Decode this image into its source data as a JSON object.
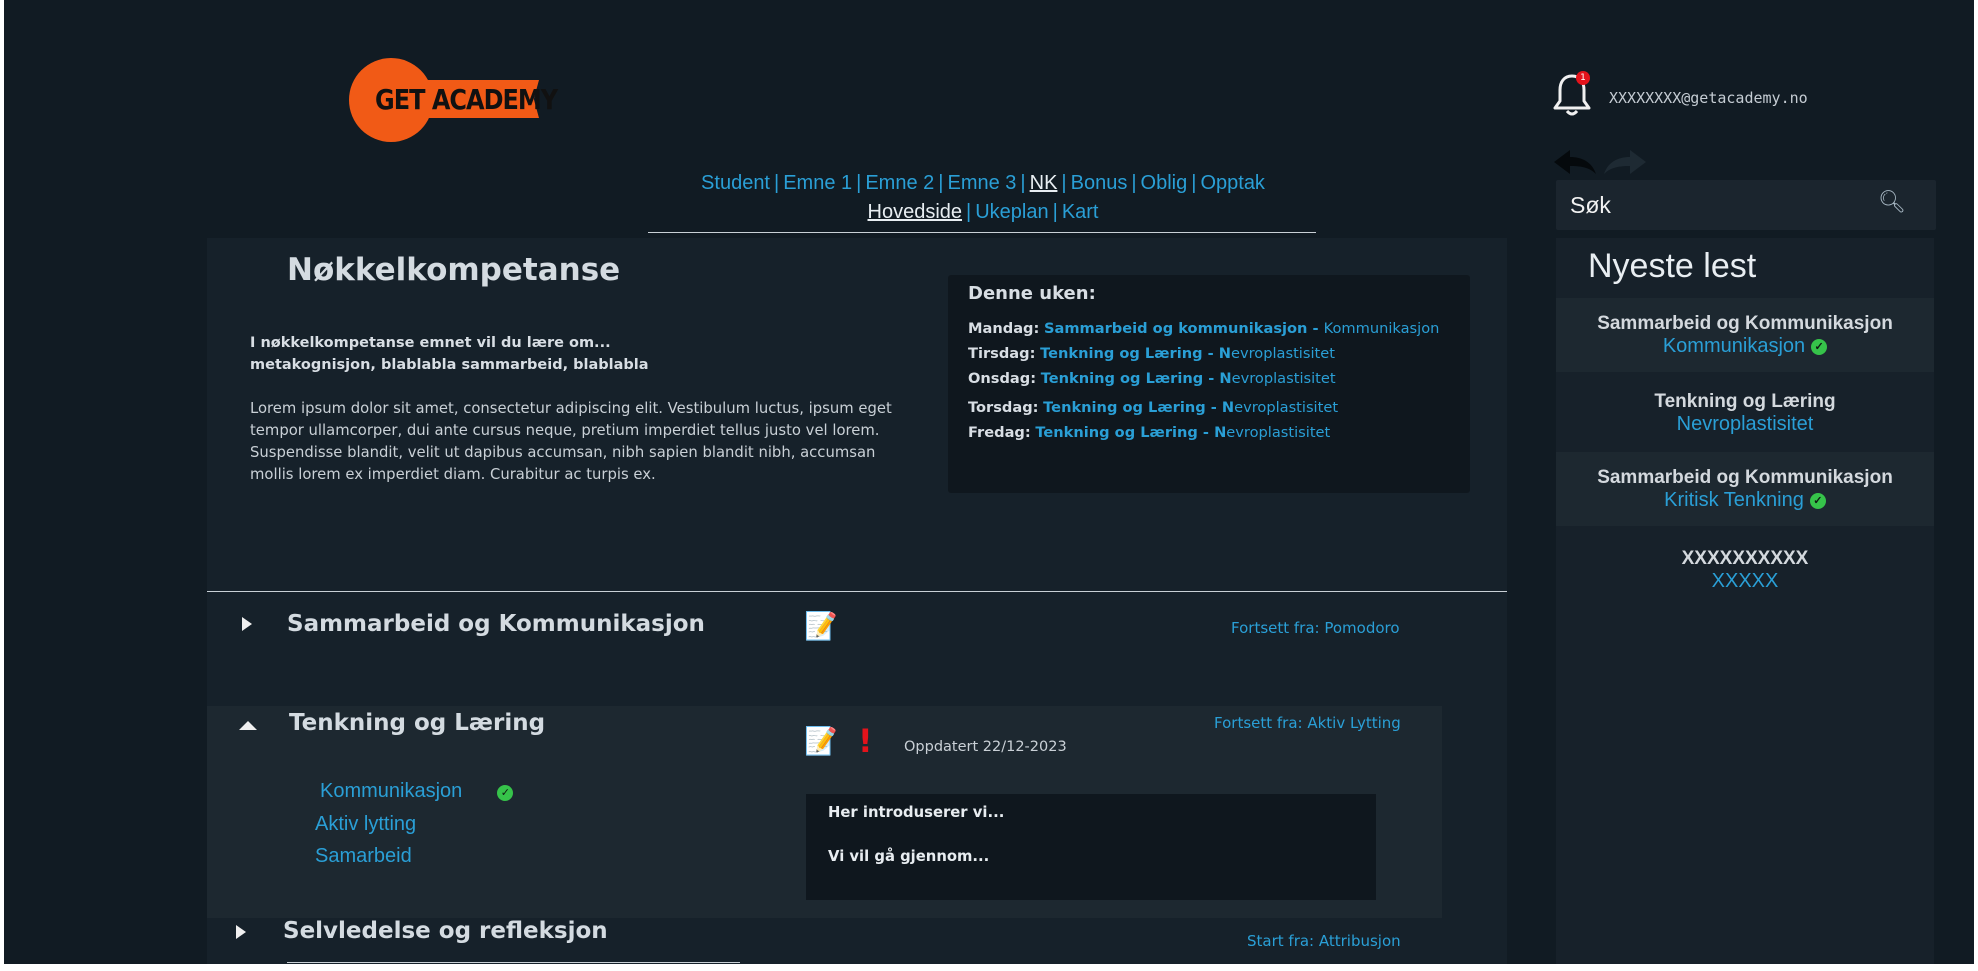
{
  "logo": {
    "text": "GET ACADEMY"
  },
  "nav": {
    "primary": [
      {
        "label": "Student",
        "active": false
      },
      {
        "label": "Emne 1",
        "active": false
      },
      {
        "label": "Emne 2",
        "active": false
      },
      {
        "label": "Emne 3",
        "active": false
      },
      {
        "label": "NK",
        "active": true
      },
      {
        "label": "Bonus",
        "active": false
      },
      {
        "label": "Oblig",
        "active": false
      },
      {
        "label": "Opptak",
        "active": false
      }
    ],
    "secondary": [
      {
        "label": "Hovedside",
        "active": true
      },
      {
        "label": "Ukeplan",
        "active": false
      },
      {
        "label": "Kart",
        "active": false
      }
    ]
  },
  "header": {
    "notification_count": "1",
    "user_email": "XXXXXXXX@getacademy.no"
  },
  "search": {
    "label": "Søk"
  },
  "recent": {
    "title": "Nyeste lest",
    "items": [
      {
        "title": "Sammarbeid og Kommunikasjon",
        "subtitle": "Kommunikasjon",
        "done": true
      },
      {
        "title": "Tenkning og Læring",
        "subtitle": "Nevroplastisitet",
        "done": false
      },
      {
        "title": "Sammarbeid og Kommunikasjon",
        "subtitle": "Kritisk Tenkning",
        "done": true
      },
      {
        "title": "XXXXXXXXXX",
        "subtitle": "XXXXX",
        "done": false
      }
    ]
  },
  "main": {
    "title": "Nøkkelkompetanse",
    "intro_line1": "I nøkkelkompetanse emnet vil du lære om...",
    "intro_line2": "metakognisjon, blablabla sammarbeid, blablabla",
    "lorem": "Lorem ipsum dolor sit amet, consectetur adipiscing elit. Vestibulum luctus, ipsum eget tempor ullamcorper, dui ante cursus neque, pretium imperdiet tellus justo vel lorem. Suspendisse blandit, velit ut dapibus accumsan, nibh sapien blandit nibh, accumsan mollis lorem ex imperdiet diam. Curabitur ac turpis ex."
  },
  "week": {
    "title": "Denne uken:",
    "rows": [
      {
        "day": "Mandag:",
        "topic": "Sammarbeid og kommunikasjon - ",
        "sub": "Kommunikasjon"
      },
      {
        "day": "Tirsdag:",
        "topic": "Tenkning og Læring - N",
        "sub": "evroplastisitet"
      },
      {
        "day": "Onsdag:",
        "topic": "Tenkning og Læring - N",
        "sub": "evroplastisitet"
      },
      {
        "day": "Torsdag:",
        "topic": "Tenkning og Læring - N",
        "sub": "evroplastisitet"
      },
      {
        "day": "Fredag:",
        "topic": "Tenkning og Læring - N",
        "sub": "evroplastisitet"
      }
    ]
  },
  "sections": [
    {
      "title": "Sammarbeid og Kommunikasjon",
      "continue": "Fortsett fra: Pomodoro"
    },
    {
      "title": "Tenkning og Læring",
      "continue": "Fortsett fra: Aktiv Lytting",
      "updated": "Oppdatert 22/12-2023",
      "subitems": [
        {
          "label": "Kommunikasjon",
          "done": true
        },
        {
          "label": "Aktiv lytting",
          "done": false
        },
        {
          "label": "Samarbeid",
          "done": false
        }
      ],
      "intro_line1": "Her introduserer vi...",
      "intro_line2": "Vi vil gå gjennom..."
    },
    {
      "title": "Selvledelse og refleksjon",
      "continue": "Start fra: Attribusjon"
    }
  ],
  "icons": {
    "memo": "memo-icon",
    "alert": "exclamation-icon",
    "check": "check-circle-icon",
    "search": "magnifier-icon",
    "bell": "bell-icon"
  },
  "colors": {
    "background": "#111b23",
    "panel": "#16212a",
    "link": "#2a9fd6",
    "brand": "#f15a16",
    "success": "#36c34a",
    "alert": "#e3131b"
  }
}
